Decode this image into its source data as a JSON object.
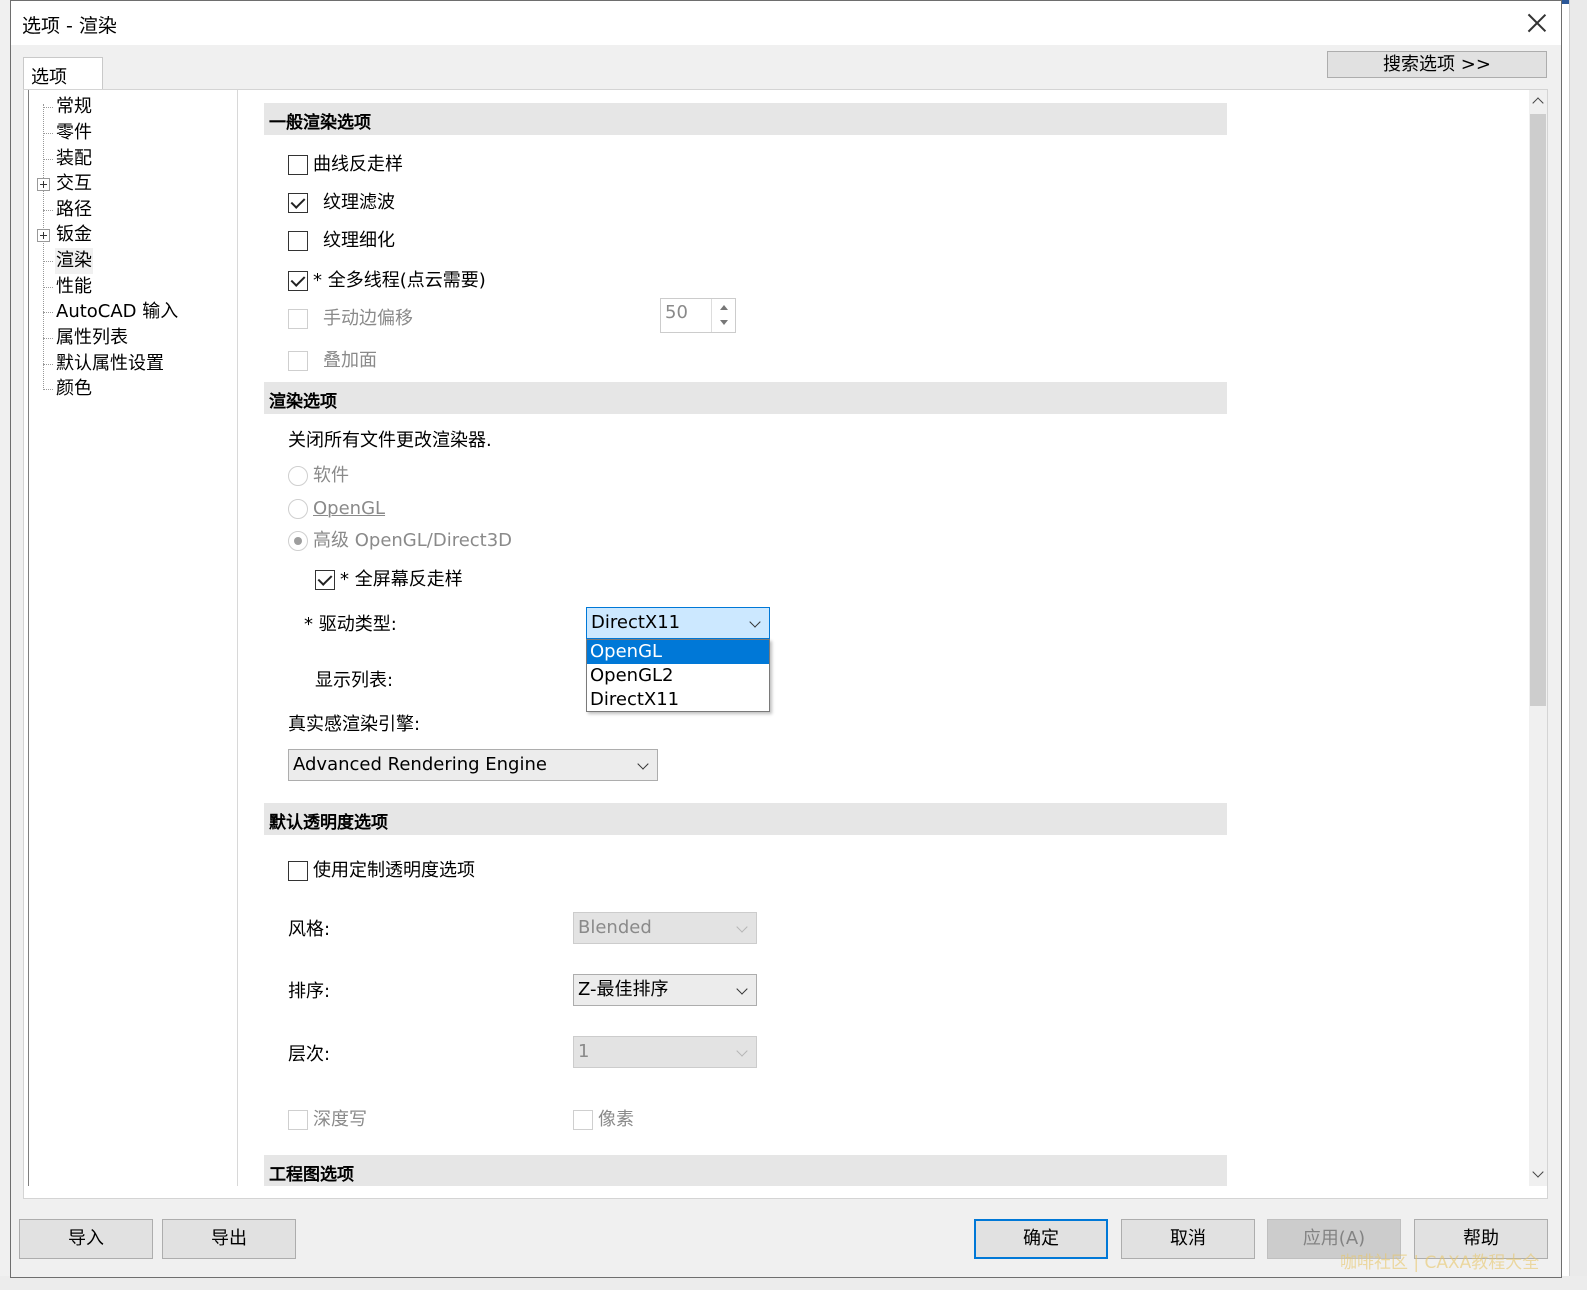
{
  "window": {
    "title": "选项 - 渲染"
  },
  "tab": {
    "label": "选项"
  },
  "search_button": "搜索选项 >>",
  "tree": {
    "items": [
      {
        "label": "常规"
      },
      {
        "label": "零件"
      },
      {
        "label": "装配"
      },
      {
        "label": "交互"
      },
      {
        "label": "路径"
      },
      {
        "label": "钣金"
      },
      {
        "label": "渲染"
      },
      {
        "label": "性能"
      },
      {
        "label": "AutoCAD 输入"
      },
      {
        "label": "属性列表"
      },
      {
        "label": "默认属性设置"
      },
      {
        "label": "颜色"
      }
    ]
  },
  "general": {
    "header": "一般渲染选项",
    "curve_aa": "曲线反走样",
    "texture_filter": "纹理滤波",
    "texture_refine": "纹理细化",
    "multithread": "* 全多线程(点云需要)",
    "manual_edge_offset": "手动边偏移",
    "edge_offset_value": "50",
    "overlay_face": "叠加面"
  },
  "render": {
    "header": "渲染选项",
    "note": "关闭所有文件更改渲染器.",
    "radio_software": "软件",
    "radio_opengl": "OpenGL",
    "radio_advanced": "高级 OpenGL/Direct3D",
    "fullscreen_aa": "* 全屏幕反走样",
    "driver_label": "* 驱动类型:",
    "driver_value": "DirectX11",
    "driver_options": [
      "OpenGL",
      "OpenGL2",
      "DirectX11"
    ],
    "display_list_label": "显示列表:",
    "engine_label": "真实感渲染引擎:",
    "engine_value": "Advanced Rendering Engine"
  },
  "transparency": {
    "header": "默认透明度选项",
    "custom": "使用定制透明度选项",
    "style_label": "风格:",
    "style_value": "Blended",
    "sort_label": "排序:",
    "sort_value": "Z-最佳排序",
    "level_label": "层次:",
    "level_value": "1",
    "depth_write": "深度写",
    "pixel": "像素"
  },
  "drawing": {
    "header": "工程图选项"
  },
  "buttons": {
    "import": "导入",
    "export": "导出",
    "ok": "确定",
    "cancel": "取消",
    "apply": "应用(A)",
    "help": "帮助"
  },
  "watermark": "咖啡社区 | CAXA教程大全"
}
